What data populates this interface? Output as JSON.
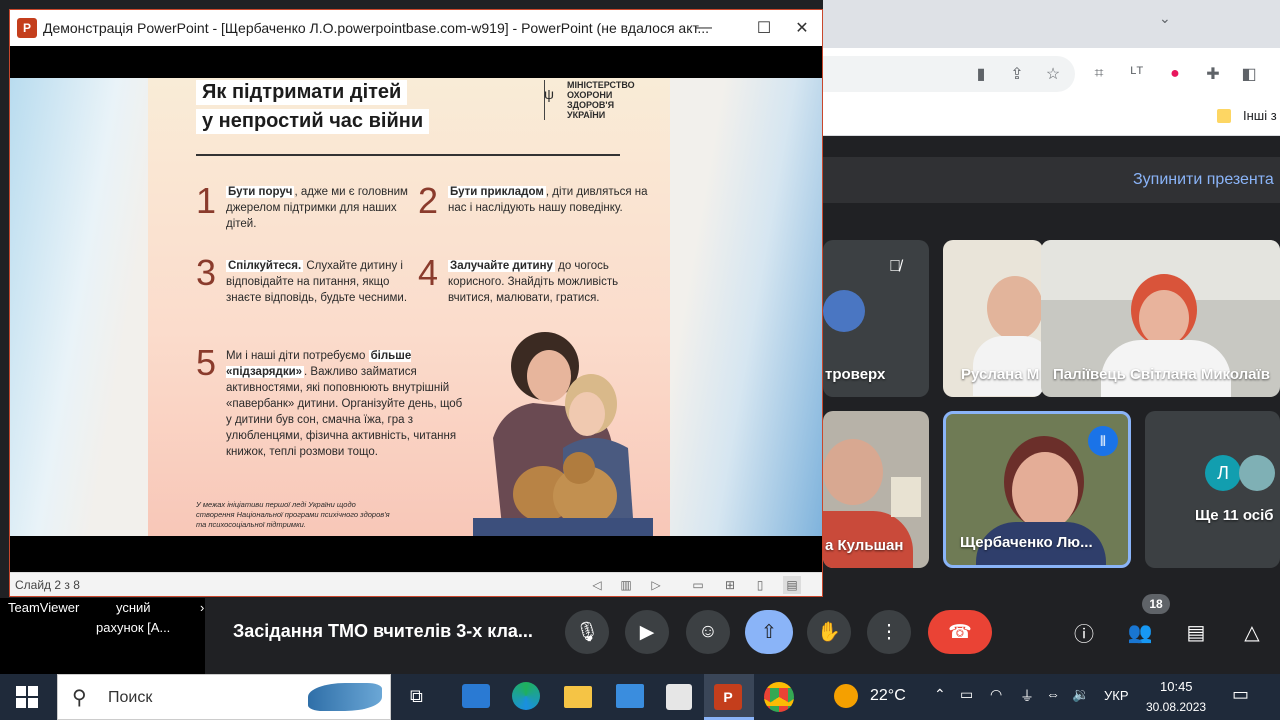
{
  "ppt": {
    "title": "Демонстрація PowerPoint - [Щербаченко Л.О.powerpointbase.com-w919] - PowerPoint (не вдалося акт...",
    "status_slide": "Слайд 2 з 8",
    "slide": {
      "heading_line1": "Як підтримати дітей",
      "heading_line2": "у непростий час війни",
      "ministry_line1": "МІНІСТЕРСТВО",
      "ministry_line2": "ОХОРОНИ",
      "ministry_line3": "ЗДОРОВ'Я",
      "ministry_line4": "УКРАЇНИ",
      "tips": [
        {
          "num": "1",
          "bold": "Бути поруч",
          "text": ", адже ми є головним джерелом підтримки для наших дітей."
        },
        {
          "num": "2",
          "bold": "Бути прикладом",
          "text": ", діти дивляться на нас і наслідують нашу поведінку."
        },
        {
          "num": "3",
          "bold": "Спілкуйтеся.",
          "text": " Слухайте дитину і відповідайте на питання, якщо знаєте відповідь, будьте чесними."
        },
        {
          "num": "4",
          "bold": "Залучайте дитину",
          "text": " до чогось корисного. Знайдіть можливість вчитися, малювати, гратися."
        },
        {
          "num": "5",
          "pre": "Ми і наші діти потребуємо ",
          "bold": "більше «підзарядки»",
          "text": ". Важливо займатися активностями, які поповнюють внутрішній «павербанк» дитини. Організуйте день, щоб у дитини був сон, смачна їжа, гра з улюбленцями, фізична активність, читання книжок, теплі розмови тощо."
        }
      ],
      "footnote": "У межах ініціативи першої леді України щодо створення Національної програми психічного здоров'я та психосоціальної підтримки."
    }
  },
  "chrome": {
    "bookmark_label": "Інші з"
  },
  "meet": {
    "stop_presenting": "Зупинити презента",
    "tiles": {
      "t1_name": "троверх",
      "t2_name": "Руслана М",
      "t3_name": "Паліївець Світлана Миколаїв",
      "t4_name": "а Кульшан",
      "t5_name": "Щербаченко Лю...",
      "t6_name": "Ще 11 осіб",
      "t6_avatar_letter": "Л"
    },
    "meeting_title": "Засідання ТМО вчителів 3-х кла...",
    "participants_count": "18"
  },
  "teamviewer": {
    "label": "TeamViewer",
    "text1": "усний",
    "text2": "рахунок [A...",
    "text3": "›"
  },
  "taskbar": {
    "search_placeholder": "Поиск",
    "weather": "22°C",
    "lang": "УКР",
    "time": "10:45",
    "date": "30.08.2023"
  },
  "colors": {
    "meet_bg": "#202124",
    "accent_blue": "#8ab4f8",
    "hangup_red": "#ea4335",
    "ppt_red": "#c43e1c"
  }
}
